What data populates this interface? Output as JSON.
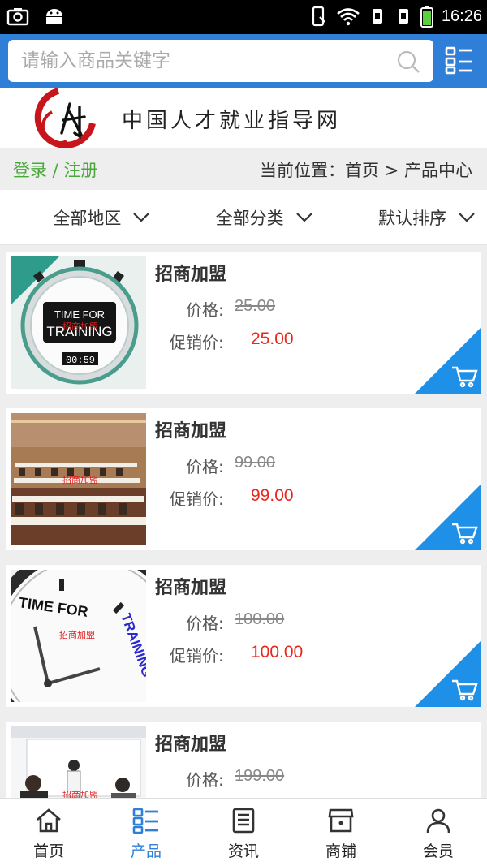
{
  "status_bar": {
    "time": "16:26"
  },
  "search": {
    "placeholder": "请输入商品关键字"
  },
  "site": {
    "name": "中国人才就业指导网"
  },
  "auth": {
    "login": "登录",
    "separator": " / ",
    "register": "注册"
  },
  "breadcrumb": {
    "prefix": "当前位置：",
    "home": "首页",
    "sep": " > ",
    "current": "产品中心"
  },
  "filters": [
    {
      "label": "全部地区"
    },
    {
      "label": "全部分类"
    },
    {
      "label": "默认排序"
    }
  ],
  "products": [
    {
      "title": "招商加盟",
      "price_label": "价格:",
      "price": "25.00",
      "sale_label": "促销价:",
      "sale_price": "25.00",
      "image": "stopwatch-time-for-training",
      "image_text": [
        "TIME FOR",
        "TRAINING",
        "00:59"
      ],
      "watermark": "招商加盟"
    },
    {
      "title": "招商加盟",
      "price_label": "价格:",
      "price": "99.00",
      "sale_label": "促销价:",
      "sale_price": "99.00",
      "image": "conference-room",
      "image_text": [],
      "watermark": "招商加盟"
    },
    {
      "title": "招商加盟",
      "price_label": "价格:",
      "price": "100.00",
      "sale_label": "促销价:",
      "sale_price": "100.00",
      "image": "clock-time-for-training",
      "image_text": [
        "TIME FOR",
        "TRAINING"
      ],
      "watermark": "招商加盟"
    },
    {
      "title": "招商加盟",
      "price_label": "价格:",
      "price": "199.00",
      "sale_label": "",
      "sale_price": "",
      "image": "presentation-meeting",
      "image_text": [],
      "watermark": "招商加盟"
    }
  ],
  "bottom_nav": [
    {
      "label": "首页",
      "icon": "home-icon",
      "active": false
    },
    {
      "label": "产品",
      "icon": "list-icon",
      "active": true
    },
    {
      "label": "资讯",
      "icon": "news-icon",
      "active": false
    },
    {
      "label": "商铺",
      "icon": "shop-icon",
      "active": false
    },
    {
      "label": "会员",
      "icon": "user-icon",
      "active": false
    }
  ],
  "colors": {
    "brand_blue": "#2f7fd8",
    "sale_red": "#e8261c",
    "auth_green": "#4aa83a",
    "cart_blue": "#1e90e8"
  }
}
